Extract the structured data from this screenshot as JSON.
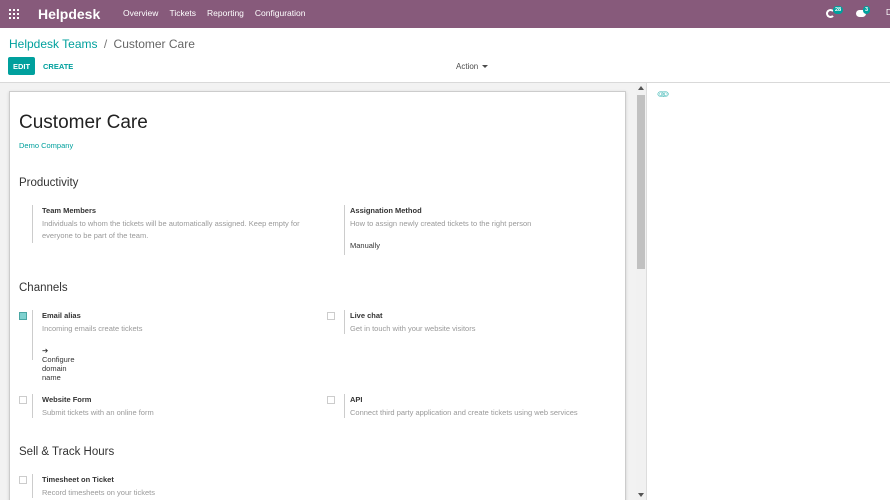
{
  "navbar": {
    "brand": "Helpdesk",
    "menu": [
      "Overview",
      "Tickets",
      "Reporting",
      "Configuration"
    ],
    "activity_badge": "28",
    "messages_badge": "3",
    "user_initial": "D"
  },
  "breadcrumb": {
    "parent": "Helpdesk Teams",
    "separator": "/",
    "current": "Customer Care"
  },
  "toolbar": {
    "edit_label": "EDIT",
    "create_label": "CREATE",
    "action_label": "Action"
  },
  "form": {
    "title": "Customer Care",
    "company": "Demo Company",
    "sections": {
      "productivity": "Productivity",
      "channels": "Channels",
      "sell_track": "Sell & Track Hours"
    },
    "team_members": {
      "label": "Team Members",
      "description": "Individuals to whom the tickets will be automatically assigned. Keep empty for everyone to be part of the team."
    },
    "assignation": {
      "label": "Assignation Method",
      "description": "How to assign newly created tickets to the right person",
      "value": "Manually"
    },
    "email_alias": {
      "label": "Email alias",
      "description": "Incoming emails create tickets",
      "link": "Configure domain name",
      "checked": true
    },
    "live_chat": {
      "label": "Live chat",
      "description": "Get in touch with your website visitors",
      "checked": false
    },
    "website_form": {
      "label": "Website Form",
      "description": "Submit tickets with an online form",
      "checked": false
    },
    "api": {
      "label": "API",
      "description": "Connect third party application and create tickets using web services",
      "checked": false
    },
    "timesheet": {
      "label": "Timesheet on Ticket",
      "description": "Record timesheets on your tickets",
      "checked": false
    }
  },
  "colors": {
    "brand": "#875a7b",
    "accent": "#00a09d"
  }
}
